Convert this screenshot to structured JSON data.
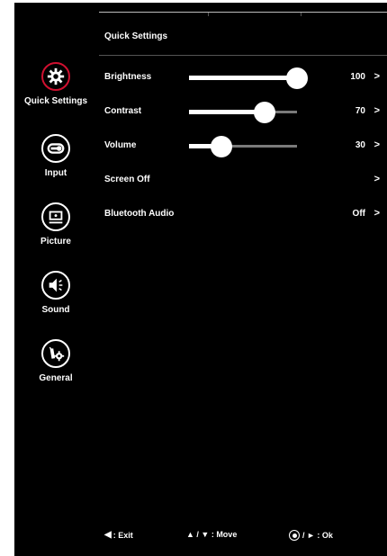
{
  "panel": {
    "title": "Quick Settings"
  },
  "sidebar": {
    "items": [
      {
        "label": "Quick Settings",
        "icon": "gear-icon",
        "active": true
      },
      {
        "label": "Input",
        "icon": "input-icon",
        "active": false
      },
      {
        "label": "Picture",
        "icon": "picture-icon",
        "active": false
      },
      {
        "label": "Sound",
        "icon": "speaker-icon",
        "active": false
      },
      {
        "label": "General",
        "icon": "wrench-gear-icon",
        "active": false
      }
    ]
  },
  "settings": [
    {
      "label": "Brightness",
      "value": "100",
      "level": 100,
      "slider": true
    },
    {
      "label": "Contrast",
      "value": "70",
      "level": 70,
      "slider": true
    },
    {
      "label": "Volume",
      "value": "30",
      "level": 30,
      "slider": true
    },
    {
      "label": "Screen Off",
      "value": "",
      "slider": false
    },
    {
      "label": "Bluetooth Audio",
      "value": "Off",
      "slider": false
    }
  ],
  "arrow": ">",
  "hints": {
    "exit": ": Exit",
    "move": "▲ / ▼ : Move",
    "ok": "/ ► : Ok"
  },
  "colors": {
    "background": "#000000",
    "accent": "#d01030",
    "text": "#ffffff",
    "slider_track": "#7a7a7a"
  }
}
